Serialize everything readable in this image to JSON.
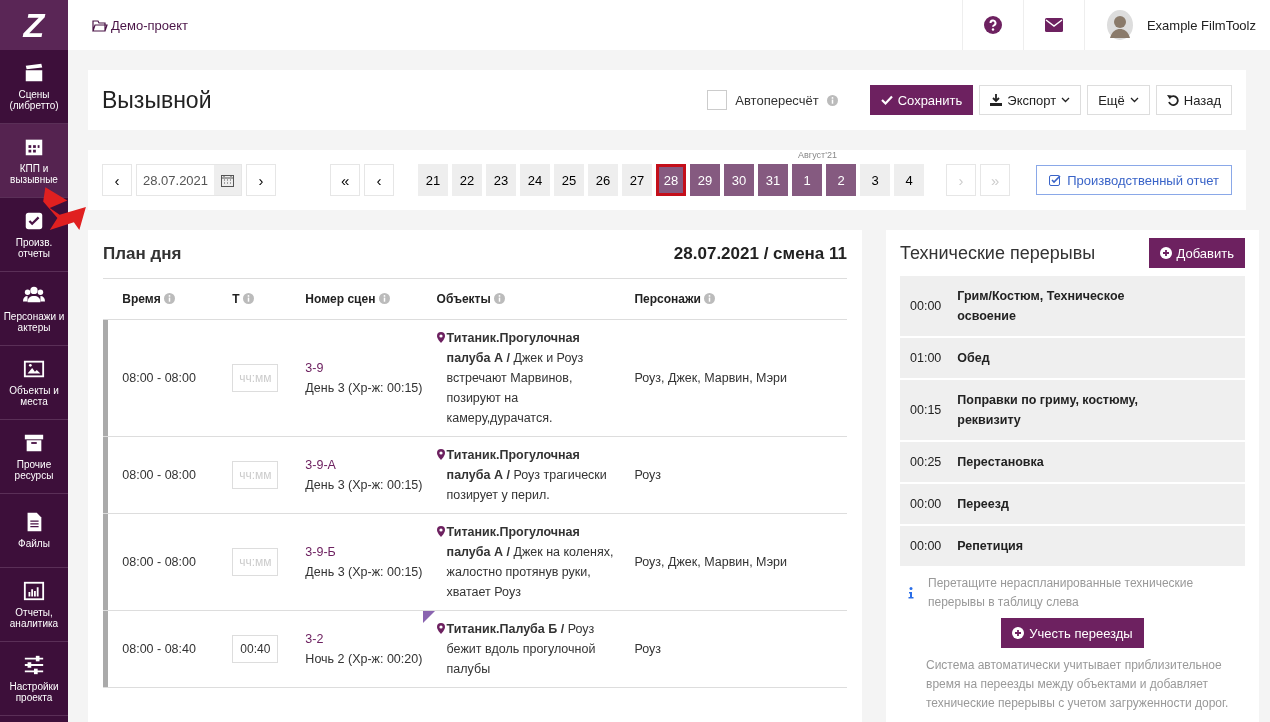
{
  "logo": "Z",
  "sidebar": {
    "items": [
      {
        "label": "Сцены (либретто)",
        "selected": false
      },
      {
        "label": "КПП и вызывные",
        "selected": true
      },
      {
        "label": "Произв. отчеты",
        "selected": false
      },
      {
        "label": "Персонажи и актеры",
        "selected": false
      },
      {
        "label": "Объекты и места",
        "selected": false
      },
      {
        "label": "Прочие ресурсы",
        "selected": false
      },
      {
        "label": "Файлы",
        "selected": false
      },
      {
        "label": "Отчеты, аналитика",
        "selected": false
      },
      {
        "label": "Настройки проекта",
        "selected": false
      }
    ]
  },
  "topbar": {
    "project": "Демо-проект",
    "user": "Example FilmToolz"
  },
  "header": {
    "title": "Вызывной",
    "autorecalc": {
      "label": "Автопересчёт",
      "checked": false
    },
    "buttons": [
      {
        "label": "Сохранить",
        "kind": "save"
      },
      {
        "label": "Экспорт",
        "kind": "export"
      },
      {
        "label": "Ещё",
        "kind": "more"
      },
      {
        "label": "Назад",
        "kind": "back"
      }
    ]
  },
  "date_nav": {
    "prev": "‹",
    "date": "28.07.2021",
    "next": "›",
    "first": "«",
    "back": "‹",
    "fwd": "›",
    "last": "»",
    "month_label": "Август'21",
    "report_button": "Производственный отчет",
    "days": [
      {
        "label": "21",
        "shooting": false,
        "selected": false
      },
      {
        "label": "22",
        "shooting": false,
        "selected": false
      },
      {
        "label": "23",
        "shooting": false,
        "selected": false
      },
      {
        "label": "24",
        "shooting": false,
        "selected": false
      },
      {
        "label": "25",
        "shooting": false,
        "selected": false
      },
      {
        "label": "26",
        "shooting": false,
        "selected": false
      },
      {
        "label": "27",
        "shooting": false,
        "selected": false
      },
      {
        "label": "28",
        "shooting": true,
        "selected": true
      },
      {
        "label": "29",
        "shooting": true,
        "selected": false
      },
      {
        "label": "30",
        "shooting": true,
        "selected": false
      },
      {
        "label": "31",
        "shooting": true,
        "selected": false
      },
      {
        "label": "1",
        "shooting": true,
        "selected": false,
        "month_start": true
      },
      {
        "label": "2",
        "shooting": true,
        "selected": false
      },
      {
        "label": "3",
        "shooting": false,
        "selected": false
      },
      {
        "label": "4",
        "shooting": false,
        "selected": false
      }
    ]
  },
  "plan": {
    "title": "План дня",
    "subtitle": "28.07.2021 / смена 11",
    "columns": [
      "Время",
      "Т",
      "Номер сцен",
      "Объекты",
      "Персонажи"
    ],
    "rows": [
      {
        "time": "08:00 - 08:00",
        "duration": "",
        "placeholder": "чч:мм",
        "scene": "3-9",
        "scene_info": "День 3 (Хр-ж: 00:15)",
        "object": "Титаник.Прогулочная палуба А /",
        "description": "Джек и Роуз встречают Марвинов, позируют на камеру,дурачатся.",
        "characters": "Роуз, Джек, Марвин, Мэри",
        "flagged": false
      },
      {
        "time": "08:00 - 08:00",
        "duration": "",
        "placeholder": "чч:мм",
        "scene": "3-9-А",
        "scene_info": "День 3 (Хр-ж: 00:15)",
        "object": "Титаник.Прогулочная палуба А /",
        "description": "Роуз трагически позирует у перил.",
        "characters": "Роуз",
        "flagged": false
      },
      {
        "time": "08:00 - 08:00",
        "duration": "",
        "placeholder": "чч:мм",
        "scene": "3-9-Б",
        "scene_info": "День 3 (Хр-ж: 00:15)",
        "object": "Титаник.Прогулочная палуба А /",
        "description": "Джек на коленях, жалостно протянув руки, хватает Роуз",
        "characters": "Роуз, Джек, Марвин, Мэри",
        "flagged": false
      },
      {
        "time": "08:00 - 08:40",
        "duration": "00:40",
        "scene": "3-2",
        "scene_info": "Ночь 2 (Хр-ж: 00:20)",
        "object": "Титаник.Палуба Б /",
        "description": "Роуз бежит вдоль прогулочной палубы",
        "characters": "Роуз",
        "flagged": true
      }
    ]
  },
  "breaks": {
    "title": "Технические перерывы",
    "add_button": "Добавить",
    "items": [
      {
        "time": "00:00",
        "label": "Грим/Костюм, Техническое освоение"
      },
      {
        "time": "01:00",
        "label": "Обед"
      },
      {
        "time": "00:15",
        "label": "Поправки по гриму, костюму, реквизиту"
      },
      {
        "time": "00:25",
        "label": "Перестановка"
      },
      {
        "time": "00:00",
        "label": "Переезд"
      },
      {
        "time": "00:00",
        "label": "Репетиция"
      }
    ],
    "hint": "Перетащите нераспланированные технические перерывы в таблицу слева",
    "moves_button": "Учесть переезды",
    "note": "Система автоматически учитывает приблизительное время на переезды между объектами и добавляет технические перерывы с учетом загруженности дорог."
  }
}
